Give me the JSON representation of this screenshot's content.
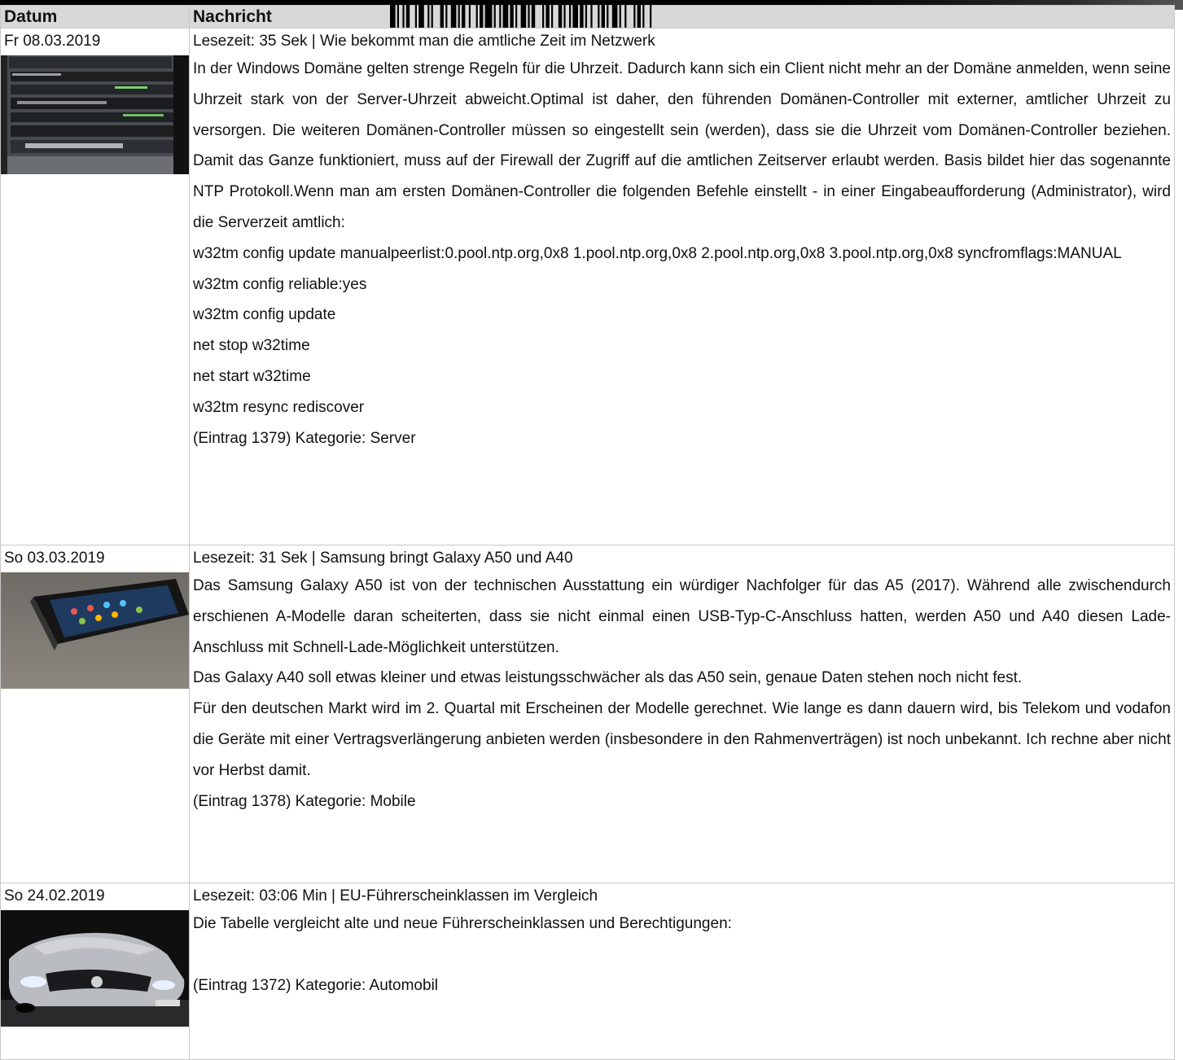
{
  "header": {
    "col_date": "Datum",
    "col_message": "Nachricht"
  },
  "entries": [
    {
      "date": "Fr 08.03.2019",
      "title": "Lesezeit: 35 Sek | Wie bekommt man die amtliche Zeit im Netzwerk",
      "image_icon": "server-rack-photo",
      "paragraphs": [
        "In der Windows Domäne gelten strenge Regeln für die Uhrzeit. Dadurch kann sich ein Client nicht mehr an der Domäne anmelden, wenn seine Uhrzeit stark von der Server-Uhrzeit abweicht.Optimal ist daher, den führenden Domänen-Controller mit externer, amtlicher Uhrzeit zu versorgen. Die weiteren Domänen-Controller müssen so eingestellt sein (werden), dass sie die Uhrzeit vom Domänen-Controller beziehen. Damit das Ganze funktioniert, muss auf der Firewall der Zugriff auf die amtlichen Zeitserver erlaubt werden. Basis bildet hier das sogenannte NTP Protokoll.Wenn man am ersten Domänen-Controller die folgenden Befehle einstellt - in einer Eingabeaufforderung (Administrator), wird die Serverzeit amtlich:",
        "w32tm config update manualpeerlist:0.pool.ntp.org,0x8 1.pool.ntp.org,0x8 2.pool.ntp.org,0x8 3.pool.ntp.org,0x8 syncfromflags:MANUAL",
        "w32tm config reliable:yes",
        "w32tm config update",
        "net stop w32time",
        "net start w32time",
        "w32tm resync rediscover"
      ],
      "footer": "(Eintrag 1379) Kategorie: Server"
    },
    {
      "date": "So 03.03.2019",
      "title": "Lesezeit: 31 Sek | Samsung bringt Galaxy A50 und A40",
      "image_icon": "smartphone-photo",
      "paragraphs": [
        "Das Samsung Galaxy A50 ist von der technischen Ausstattung ein würdiger Nachfolger für das A5 (2017). Während alle zwischendurch erschienen A-Modelle daran scheiterten, dass sie nicht einmal einen USB-Typ-C-Anschluss hatten, werden A50 und A40 diesen Lade-Anschluss mit Schnell-Lade-Möglichkeit unterstützen.",
        "Das Galaxy A40 soll etwas kleiner und etwas leistungsschwächer als das A50 sein, genaue Daten stehen noch nicht fest.",
        "Für den deutschen Markt wird im 2. Quartal mit Erscheinen der Modelle gerechnet. Wie lange es dann dauern wird, bis Telekom und vodafon die Geräte mit einer Vertragsverlängerung anbieten werden (insbesondere in den Rahmenverträgen) ist noch unbekannt. Ich rechne aber nicht vor Herbst damit."
      ],
      "footer": "(Eintrag 1378) Kategorie: Mobile"
    },
    {
      "date": "So 24.02.2019",
      "title": "Lesezeit: 03:06 Min | EU-Führerscheinklassen im Vergleich",
      "image_icon": "car-photo",
      "paragraphs": [
        "Die Tabelle vergleicht alte und neue Führerscheinklassen und Berechtigungen:",
        ""
      ],
      "footer": "(Eintrag 1372) Kategorie: Automobil"
    }
  ]
}
